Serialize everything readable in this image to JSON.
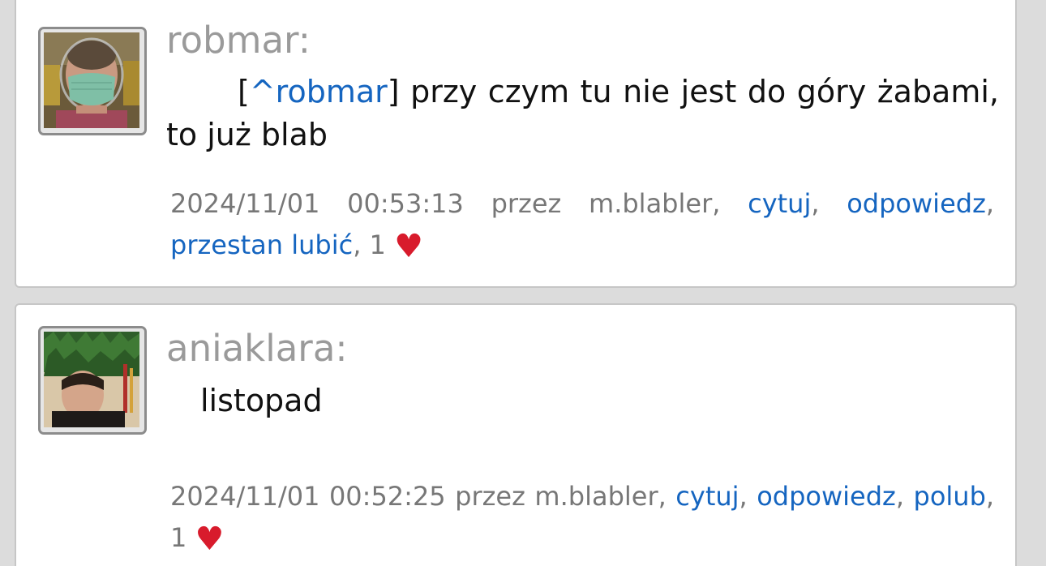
{
  "posts": [
    {
      "author": "robmar:",
      "message": {
        "bracket_open": "[",
        "mention": "^robmar",
        "bracket_close": "]",
        "text": " przy czym tu nie jest do góry żabami, to już blab"
      },
      "meta": {
        "date": "2024/11/01",
        "time": "00:53:13",
        "by_prefix": "przez",
        "by_user": "m.blabler,",
        "quote": "cytuj",
        "reply": "odpowiedz",
        "like_action": "przestan lubić",
        "like_count": "1",
        "heart": "♥"
      },
      "avatar": {
        "icon": "avatar-man-mask"
      }
    },
    {
      "author": "aniaklara:",
      "message": {
        "text": "listopad"
      },
      "meta": {
        "date": "2024/11/01",
        "time": "00:52:25",
        "by_prefix": "przez",
        "by_user": "m.blabler,",
        "quote": "cytuj",
        "reply": "odpowiedz",
        "like_action": "polub",
        "like_count": "1",
        "heart": "♥"
      },
      "avatar": {
        "icon": "avatar-woman-wreath"
      }
    }
  ],
  "colors": {
    "background": "#dcdcdc",
    "card": "#ffffff",
    "link": "#1565c0",
    "author": "#9a9a9a",
    "meta": "#777777",
    "heart": "#d81b2c"
  }
}
